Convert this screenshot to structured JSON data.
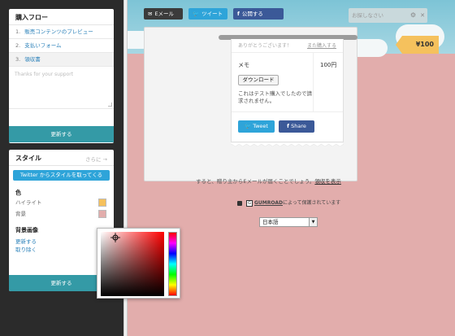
{
  "flow_panel": {
    "title": "購入フロー",
    "steps": [
      {
        "num": "1.",
        "label": "販売コンテンツのプレビュー"
      },
      {
        "num": "2.",
        "label": "支払いフォーム"
      },
      {
        "num": "3.",
        "label": "領収書"
      }
    ],
    "thanks_placeholder": "Thanks for your support",
    "update_label": "更新する"
  },
  "style_panel": {
    "title": "スタイル",
    "more": "さらに →",
    "twitter_button": "Twitter からスタイルを取ってくる",
    "color_section": "色",
    "highlight_label": "ハイライト",
    "background_label": "背景",
    "highlight_color": "#f5c15d",
    "background_color": "#e2adac",
    "bg_image_section": "背景画像",
    "update_link": "更新する",
    "remove_link": "取り除く",
    "update_label": "更新する"
  },
  "color_picker": {
    "hue_color": "#ff0000"
  },
  "preview": {
    "share": {
      "email": "Eメール",
      "tweet": "ツイート",
      "facebook": "公開する"
    },
    "search_placeholder": "お探しなさい",
    "price": "¥100",
    "receipt": {
      "thanks": "ありがとうございます！",
      "buy_again": "また購入する",
      "memo": "メモ",
      "price": "100円",
      "download": "ダウンロード",
      "note": "これはテスト購入でしたので請求されません。",
      "tweet": "Tweet",
      "share": "Share"
    },
    "info_prefix": "すると、贈り主からEメールが届くことでしょう。",
    "info_link": "領収を表示",
    "secure_brand": "GUMROAD",
    "secure_text": "によって保護されています",
    "language": "日本語"
  }
}
